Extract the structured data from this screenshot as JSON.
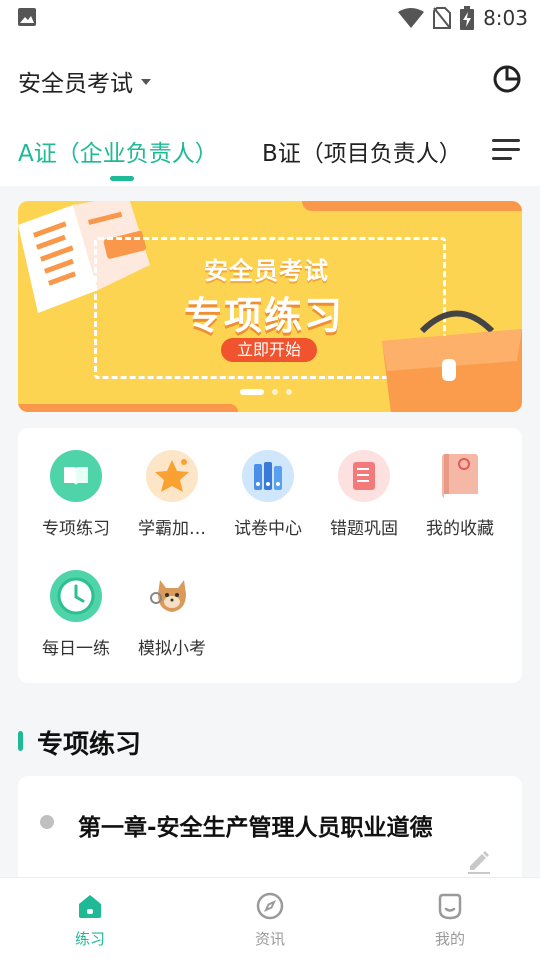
{
  "status_bar": {
    "time": "8:03"
  },
  "header": {
    "title": "安全员考试",
    "tabs": [
      {
        "label": "A证（企业负责人）",
        "active": true
      },
      {
        "label": "B证（项目负责人）",
        "active": false
      }
    ]
  },
  "banner": {
    "subtitle": "安全员考试",
    "title": "专项练习",
    "cta": "立即开始",
    "slide_count": 3,
    "active_slide": 1
  },
  "grid": {
    "items": [
      {
        "label": "专项练习",
        "icon": "book-icon"
      },
      {
        "label": "学霸加…",
        "icon": "star-icon"
      },
      {
        "label": "试卷中心",
        "icon": "binders-icon"
      },
      {
        "label": "错题巩固",
        "icon": "notebook-icon"
      },
      {
        "label": "我的收藏",
        "icon": "favorites-book-icon"
      },
      {
        "label": "每日一练",
        "icon": "clock-icon"
      },
      {
        "label": "模拟小考",
        "icon": "dog-mascot-icon"
      }
    ]
  },
  "section": {
    "title": "专项练习",
    "chapters": [
      {
        "title": "第一章-安全生产管理人员职业道德"
      }
    ]
  },
  "bottom_nav": {
    "items": [
      {
        "label": "练习",
        "active": true
      },
      {
        "label": "资讯",
        "active": false
      },
      {
        "label": "我的",
        "active": false
      }
    ]
  },
  "colors": {
    "accent": "#1fb995",
    "banner_bg": "#fdd352",
    "cta": "#f0532e",
    "inactive": "#9a9a9a"
  }
}
